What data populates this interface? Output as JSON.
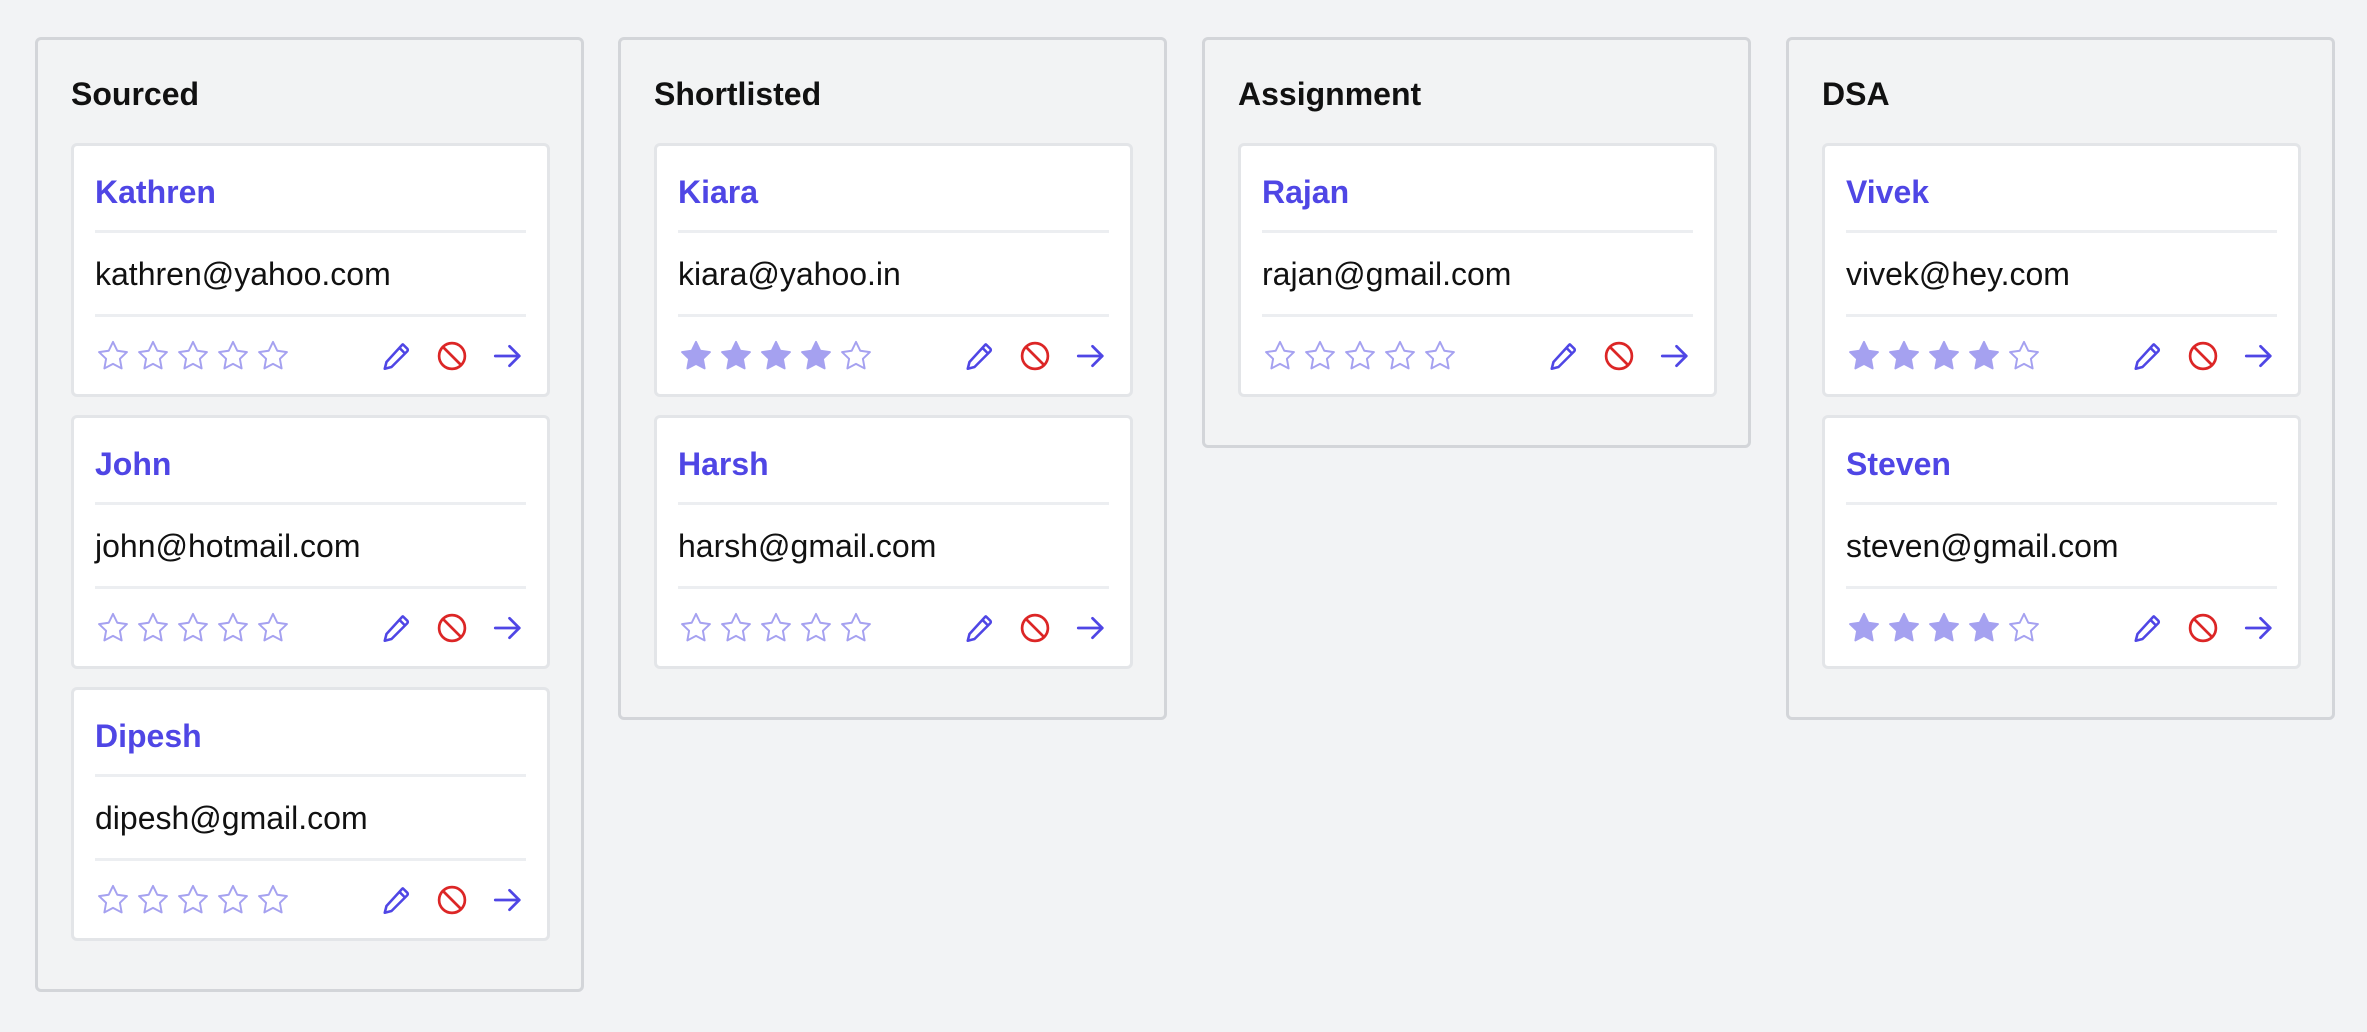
{
  "colors": {
    "accent": "#4f46e5",
    "star_filled": "#a5a1f0",
    "star_empty": "#a5a1f0",
    "block_red": "#dc2626"
  },
  "icons": {
    "edit": "pencil-icon",
    "reject": "ban-icon",
    "advance": "arrow-right-icon",
    "rating": "star-icon"
  },
  "columns": [
    {
      "title": "Sourced",
      "cards": [
        {
          "name": "Kathren",
          "email": "kathren@yahoo.com",
          "rating": 0
        },
        {
          "name": "John",
          "email": "john@hotmail.com",
          "rating": 0
        },
        {
          "name": "Dipesh",
          "email": "dipesh@gmail.com",
          "rating": 0
        }
      ]
    },
    {
      "title": "Shortlisted",
      "cards": [
        {
          "name": "Kiara",
          "email": "kiara@yahoo.in",
          "rating": 4
        },
        {
          "name": "Harsh",
          "email": "harsh@gmail.com",
          "rating": 0
        }
      ]
    },
    {
      "title": "Assignment",
      "cards": [
        {
          "name": "Rajan",
          "email": "rajan@gmail.com",
          "rating": 0
        }
      ]
    },
    {
      "title": "DSA",
      "cards": [
        {
          "name": "Vivek",
          "email": "vivek@hey.com",
          "rating": 4
        },
        {
          "name": "Steven",
          "email": "steven@gmail.com",
          "rating": 4
        }
      ]
    }
  ]
}
